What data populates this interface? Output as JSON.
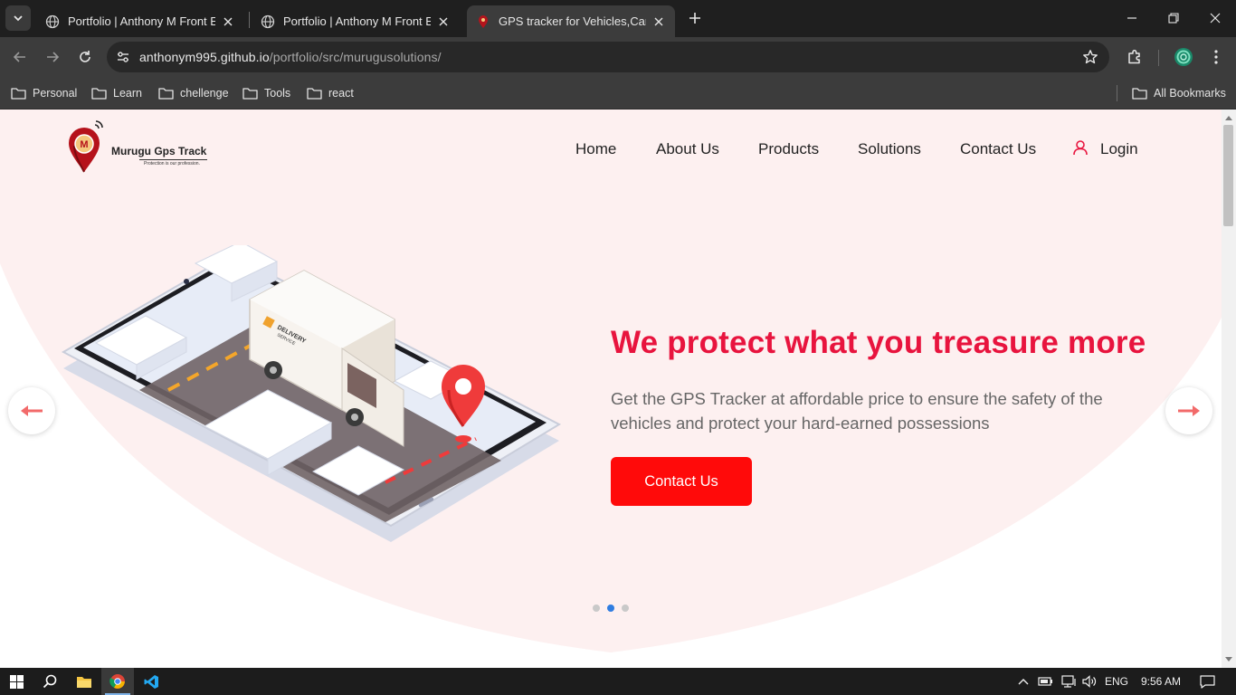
{
  "browser": {
    "tabs": [
      {
        "title": "Portfolio | Anthony M Front End Dev",
        "active": false
      },
      {
        "title": "Portfolio | Anthony M Front End Dev",
        "active": false
      },
      {
        "title": "GPS tracker for Vehicles,Cars, Bikes",
        "active": true
      }
    ],
    "url_host": "anthonym995.github.io",
    "url_path": "/portfolio/src/murugusolutions/",
    "bookmarks": [
      "Personal",
      "Learn",
      "chellenge",
      "Tools",
      "react"
    ],
    "all_bookmarks": "All Bookmarks"
  },
  "site": {
    "logo_letter": "M",
    "logo_name": "Murugu Gps Track",
    "logo_tagline": "Protection is our profession.",
    "nav": [
      "Home",
      "About Us",
      "Products",
      "Solutions",
      "Contact Us"
    ],
    "login": "Login",
    "hero": {
      "title": "We protect what you treasure more",
      "subtitle": "Get the GPS Tracker at affordable price to ensure the safety of the vehicles and protect your hard-earned possessions",
      "cta": "Contact Us",
      "van_text_1": "DELIVERY",
      "van_text_2": "SERVICE"
    },
    "carousel": {
      "slides": 3,
      "active_index": 1
    }
  },
  "taskbar": {
    "lang": "ENG",
    "time": "9:56 AM"
  },
  "colors": {
    "accent": "#e8143e",
    "cta": "#ff0a0a",
    "hero_bg": "#fdf0f0",
    "dot_active": "#2f7de1"
  }
}
